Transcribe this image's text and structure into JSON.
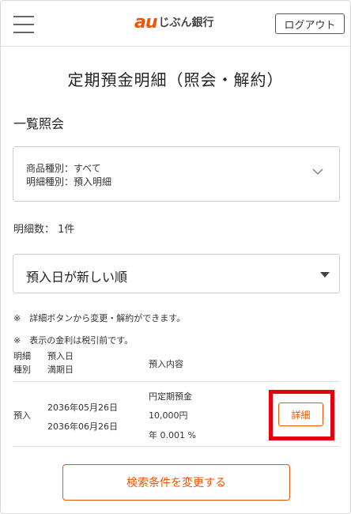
{
  "header": {
    "logo_mark": "au",
    "logo_text": "じぶん銀行",
    "logout_label": "ログアウト"
  },
  "page_title": "定期預金明細（照会・解約）",
  "section_title": "一覧照会",
  "filter": {
    "line1": "商品種別：すべて",
    "line2": "明細種別：預入明細"
  },
  "count_label": "明細数： 1件",
  "sort": {
    "selected": "預入日が新しい順"
  },
  "notes": [
    "※　詳細ボタンから変更・解約ができます。",
    "※　表示の金利は税引前です。"
  ],
  "table": {
    "headers": {
      "col1": [
        "明細",
        "種別"
      ],
      "col2": [
        "預入日",
        "満期日"
      ],
      "col3": "預入内容"
    },
    "rows": [
      {
        "type": "預入",
        "deposit_date": "2036年05月26日",
        "maturity_date": "2036年06月26日",
        "product": "円定期預金",
        "amount": "10,000円",
        "rate": "年 0.001 %",
        "detail_label": "詳細"
      }
    ]
  },
  "change_button_label": "検索条件を変更する",
  "colors": {
    "accent": "#eb5505",
    "highlight": "#e4000f"
  }
}
